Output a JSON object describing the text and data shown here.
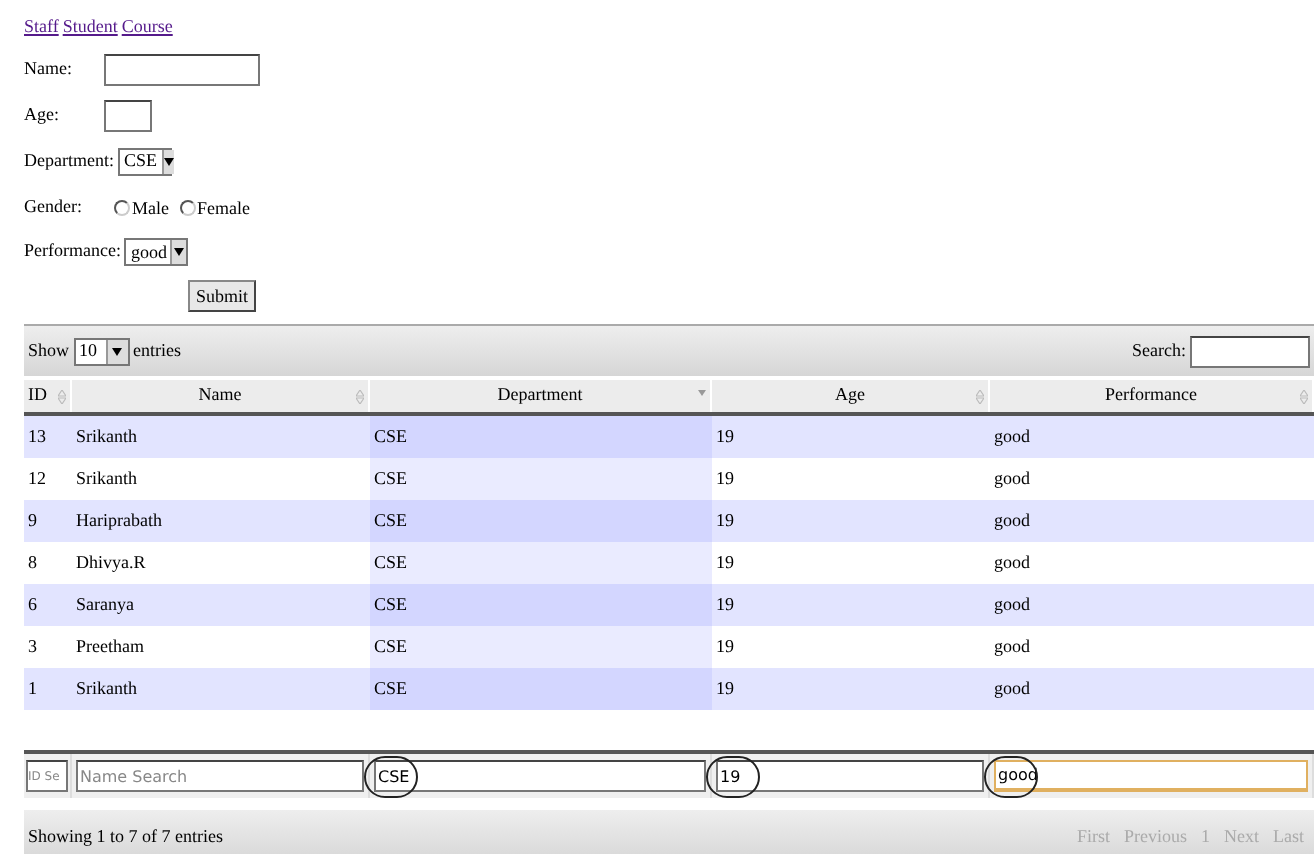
{
  "nav_links": [
    "Staff",
    "Student",
    "Course"
  ],
  "form": {
    "name_label": "Name:",
    "age_label": "Age:",
    "department_label": "Department:",
    "department_value": "CSE",
    "gender_label": "Gender:",
    "gender_options": [
      {
        "label": "Male",
        "selected": false
      },
      {
        "label": "Female",
        "selected": false
      }
    ],
    "performance_label": "Performance:",
    "performance_value": "good",
    "submit": "Submit"
  },
  "table": {
    "show_label": "Show",
    "page_size": "10",
    "entries_label": "entries",
    "search_label": "Search:",
    "columns": [
      {
        "label": "ID",
        "sorted": false
      },
      {
        "label": "Name",
        "sorted": false
      },
      {
        "label": "Department",
        "sorted": true
      },
      {
        "label": "Age",
        "sorted": false
      },
      {
        "label": "Performance",
        "sorted": false
      }
    ],
    "rows": [
      [
        "13",
        "Srikanth",
        "CSE",
        "19",
        "good"
      ],
      [
        "12",
        "Srikanth",
        "CSE",
        "19",
        "good"
      ],
      [
        "9",
        "Hariprabath",
        "CSE",
        "19",
        "good"
      ],
      [
        "8",
        "Dhivya.R",
        "CSE",
        "19",
        "good"
      ],
      [
        "6",
        "Saranya",
        "CSE",
        "19",
        "good"
      ],
      [
        "3",
        "Preetham",
        "CSE",
        "19",
        "good"
      ],
      [
        "1",
        "Srikanth",
        "CSE",
        "19",
        "good"
      ]
    ],
    "filters": [
      {
        "placeholder": "ID Se",
        "circled": false,
        "focused": false
      },
      {
        "placeholder": "Name Search",
        "circled": false,
        "focused": false
      },
      {
        "value": "CSE",
        "circled": true,
        "focused": false
      },
      {
        "value": "19",
        "circled": true,
        "focused": false
      },
      {
        "value": "good",
        "circled": true,
        "focused": true
      }
    ],
    "info": "Showing 1 to 7 of 7 entries",
    "pagination": [
      {
        "label": "First",
        "disabled": true
      },
      {
        "label": "Previous",
        "disabled": true
      },
      {
        "label": "1",
        "disabled": true
      },
      {
        "label": "Next",
        "disabled": true
      },
      {
        "label": "Last",
        "disabled": true
      }
    ]
  }
}
